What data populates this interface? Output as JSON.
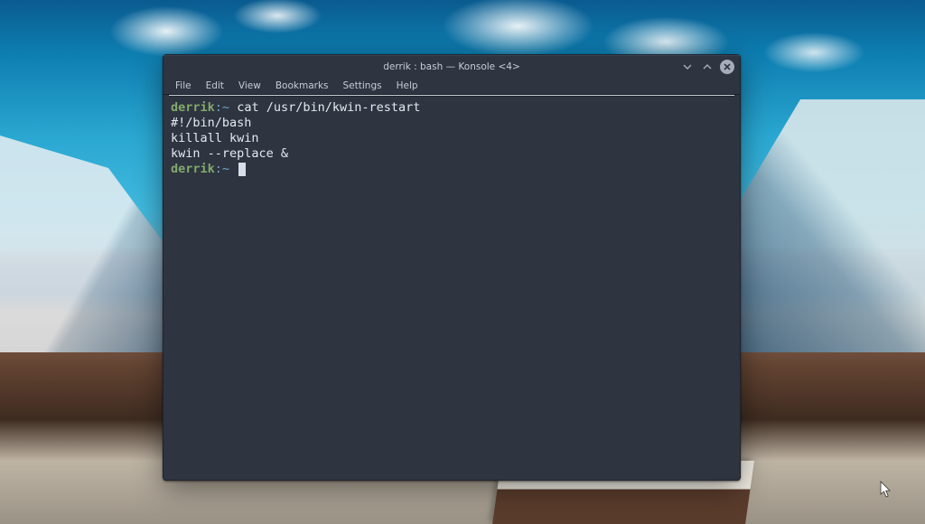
{
  "window": {
    "title": "derrik : bash — Konsole <4>"
  },
  "menu": {
    "file": "File",
    "edit": "Edit",
    "view": "View",
    "bookmarks": "Bookmarks",
    "settings": "Settings",
    "help": "Help"
  },
  "terminal": {
    "line1": {
      "user": "derrik",
      "sep": ":",
      "path": "~",
      "cmd": "cat /usr/bin/kwin-restart"
    },
    "out1": "#!/bin/bash",
    "out2": "killall kwin",
    "out3": "kwin --replace &",
    "line2": {
      "user": "derrik",
      "sep": ":",
      "path": "~"
    }
  },
  "colors": {
    "window_bg": "#2e3440",
    "prompt_user": "#83a96c",
    "prompt_path": "#6ea8cc",
    "text": "#e5e9f0"
  }
}
